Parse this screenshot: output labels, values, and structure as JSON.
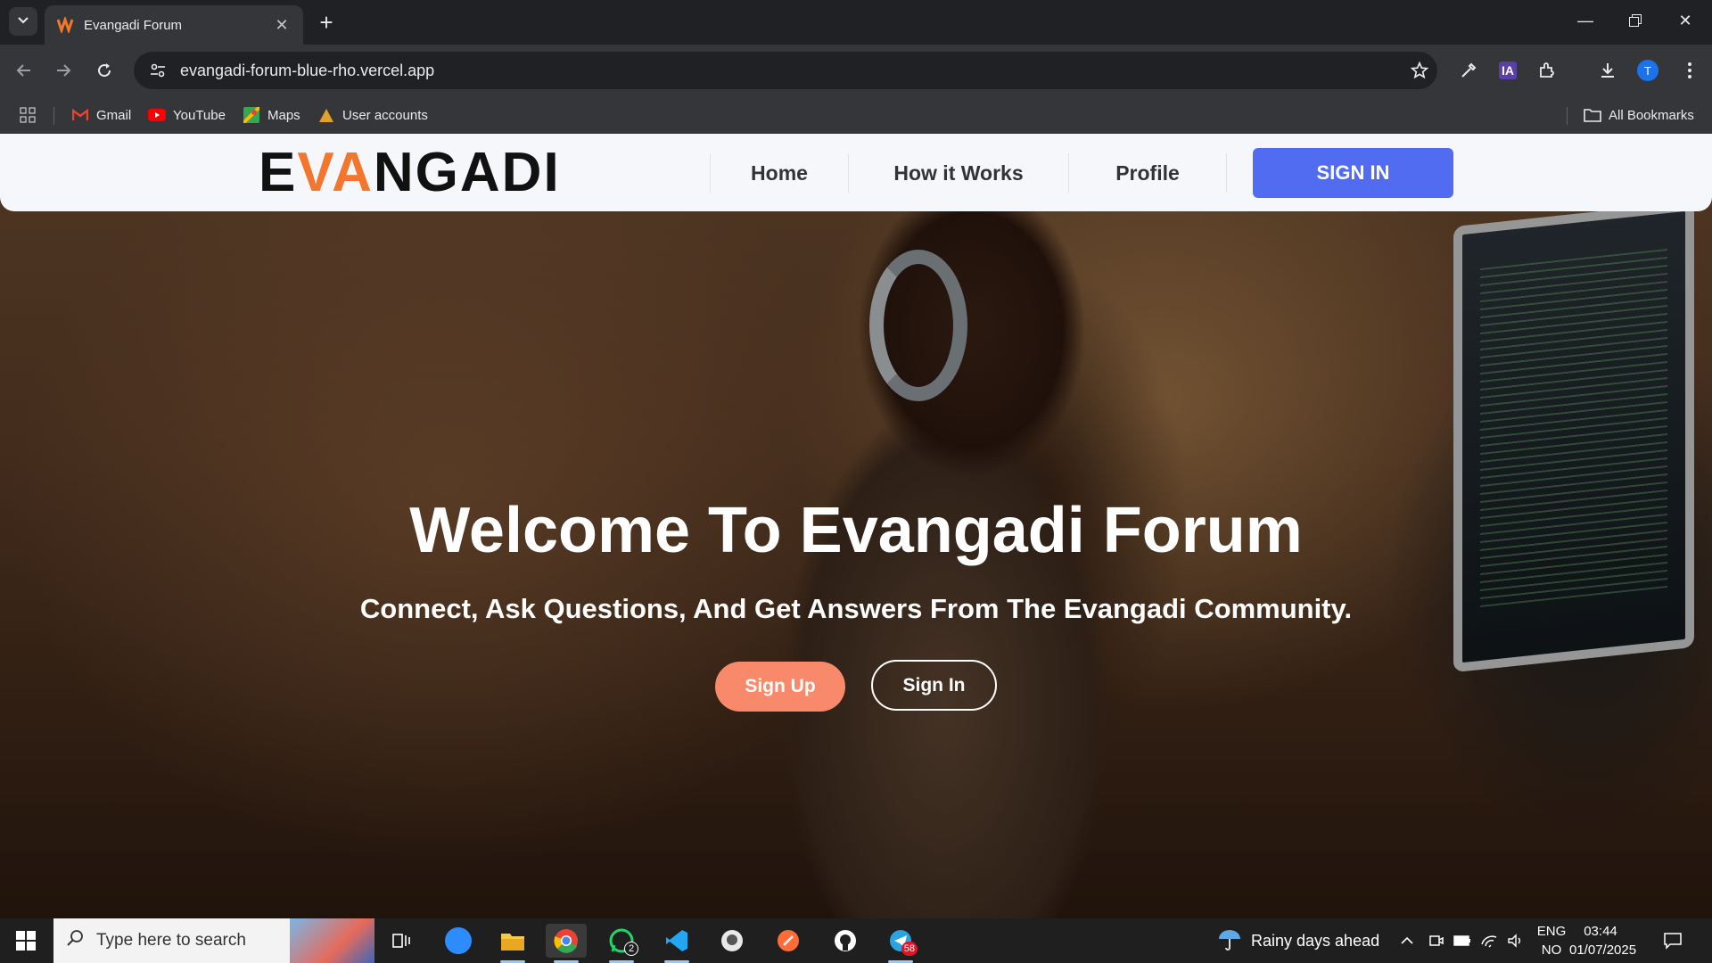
{
  "browser": {
    "tab_title": "Evangadi Forum",
    "url": "evangadi-forum-blue-rho.vercel.app",
    "bookmarks": [
      {
        "label": "Gmail",
        "icon": "gmail-icon"
      },
      {
        "label": "YouTube",
        "icon": "youtube-icon"
      },
      {
        "label": "Maps",
        "icon": "maps-icon"
      },
      {
        "label": "User accounts",
        "icon": "user-accounts-icon"
      }
    ],
    "all_bookmarks": "All Bookmarks",
    "profile_initial": "T",
    "extension_label": "IA"
  },
  "site": {
    "logo": {
      "part1": "E",
      "accent": "VA",
      "part2": "NGADI"
    },
    "nav": {
      "home": "Home",
      "how": "How it Works",
      "profile": "Profile",
      "signin": "SIGN IN"
    },
    "hero": {
      "title": "Welcome To Evangadi Forum",
      "subtitle": "Connect, Ask Questions, And Get Answers From The Evangadi Community.",
      "signup": "Sign Up",
      "signin": "Sign In"
    },
    "colors": {
      "primary": "#516cf0",
      "accent": "#f88a6b",
      "logo_accent": "#f2762e"
    }
  },
  "taskbar": {
    "search_placeholder": "Type here to search",
    "whatsapp_badge": "2",
    "telegram_badge": "58",
    "weather": "Rainy days ahead",
    "lang_top": "ENG",
    "lang_bottom": "NO",
    "time": "03:44",
    "date": "01/07/2025"
  }
}
